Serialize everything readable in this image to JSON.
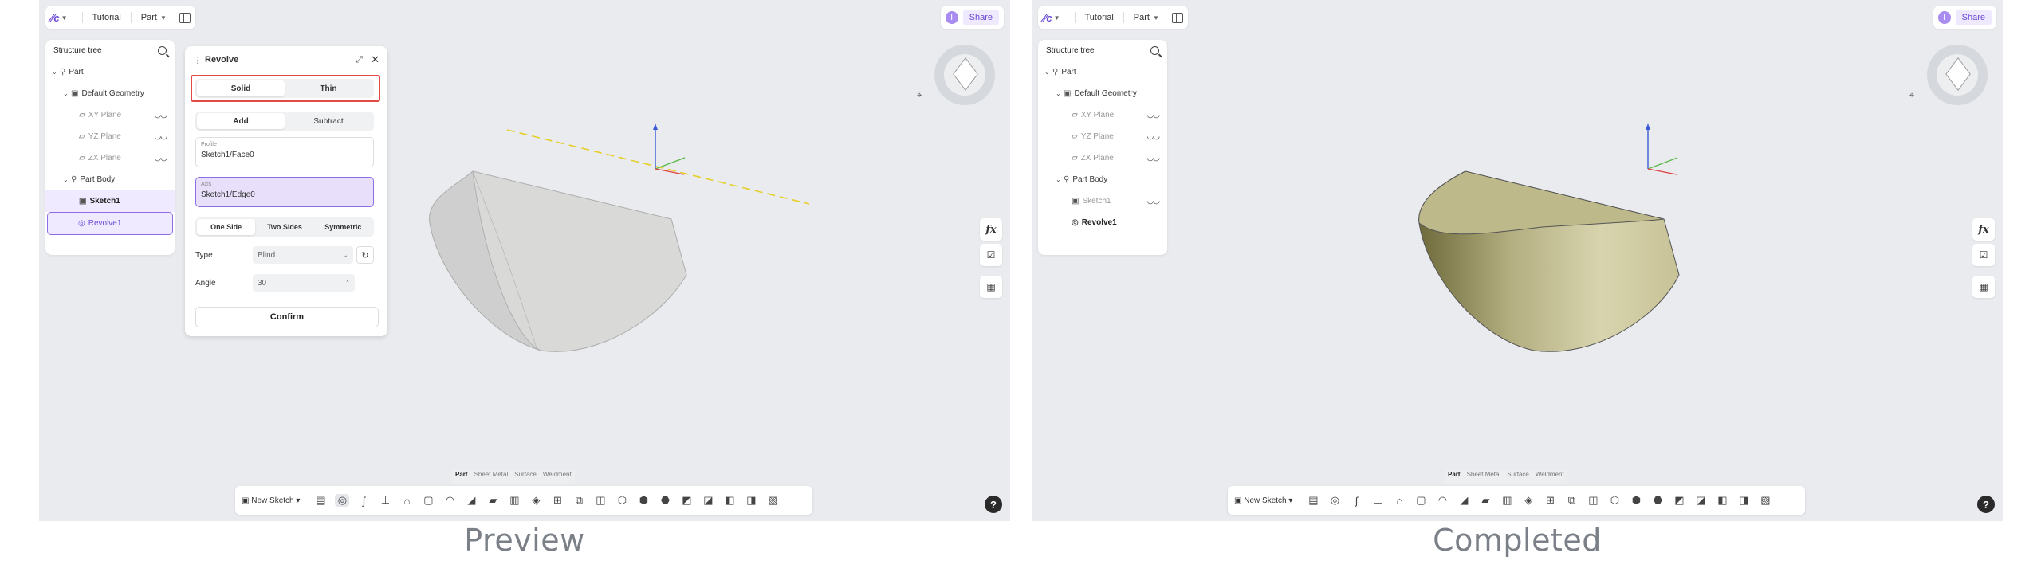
{
  "captions": {
    "preview": "Preview",
    "completed": "Completed"
  },
  "topbar": {
    "logo": "∕∕c",
    "tutorial": "Tutorial",
    "part": "Part",
    "share": "Share",
    "avatar": "I"
  },
  "tree": {
    "title": "Structure tree",
    "items": [
      "Part",
      "Default Geometry",
      "XY Plane",
      "YZ Plane",
      "ZX Plane",
      "Part Body",
      "Sketch1",
      "Revolve1"
    ]
  },
  "revolve": {
    "title": "Revolve",
    "type_options": [
      "Solid",
      "Thin"
    ],
    "op_options": [
      "Add",
      "Subtract"
    ],
    "profile_label": "Profile",
    "profile_value": "Sketch1/Face0",
    "axis_label": "Axis",
    "axis_value": "Sketch1/Edge0",
    "side_options": [
      "One Side",
      "Two Sides",
      "Symmetric"
    ],
    "type_label": "Type",
    "type_value": "Blind",
    "angle_label": "Angle",
    "angle_value": "30",
    "confirm": "Confirm"
  },
  "mode_tabs": [
    "Part",
    "Sheet Metal",
    "Surface",
    "Weldment"
  ],
  "toolbar": {
    "new_sketch": "New Sketch"
  },
  "right_tools": {
    "fx": "fx"
  },
  "help": "?",
  "colors": {
    "accent": "#6b4bd6",
    "highlight_box": "#e04b45",
    "solid_fill": "#b7b283",
    "preview_fill": "#cfd0cf"
  },
  "icons": [
    "search-icon",
    "eye-icon",
    "close-icon",
    "pin-icon",
    "reset-icon",
    "help-icon",
    "view-cube-icon"
  ]
}
